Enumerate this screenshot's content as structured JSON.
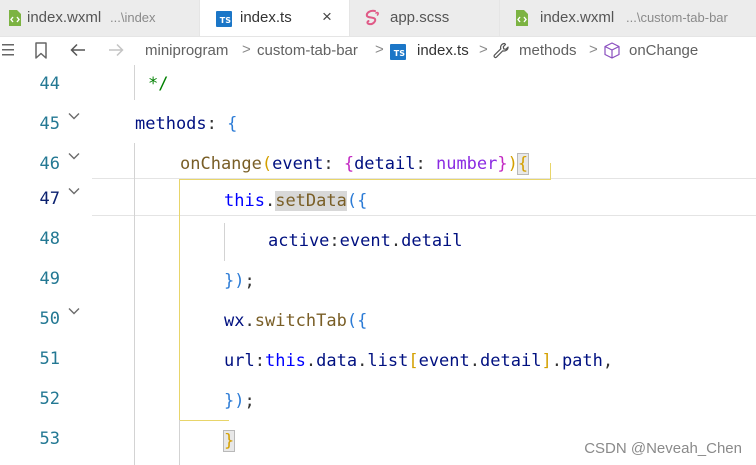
{
  "tabs": [
    {
      "label": "index.wxml",
      "description": "...\\index",
      "icon": "wxml-file-icon",
      "active": false
    },
    {
      "label": "index.ts",
      "description": "",
      "icon": "typescript-file-icon",
      "active": true,
      "close": "×"
    },
    {
      "label": "app.scss",
      "description": "",
      "icon": "sass-file-icon",
      "active": false
    },
    {
      "label": "index.wxml",
      "description": "...\\custom-tab-bar",
      "icon": "wxml-file-icon",
      "active": false
    }
  ],
  "ts_badge": "TS",
  "breadcrumb": {
    "items": [
      "miniprogram",
      "custom-tab-bar",
      "index.ts",
      "methods",
      "onChange"
    ],
    "separator": ">"
  },
  "editor": {
    "line_numbers": [
      "44",
      "45",
      "46",
      "47",
      "48",
      "49",
      "50",
      "51",
      "52",
      "53"
    ],
    "current_line": "47",
    "tokens": {
      "l44": [
        "*/"
      ],
      "l45": [
        "methods",
        ": ",
        "{"
      ],
      "l46": [
        "onChange",
        "(",
        "event",
        ": ",
        "{",
        "detail",
        ": ",
        "number",
        "}",
        ")",
        "{"
      ],
      "l47": [
        "this",
        ".",
        "setData",
        "(",
        "{"
      ],
      "l48": [
        "active",
        ":",
        "event",
        ".",
        "detail"
      ],
      "l49": [
        "}",
        ")",
        ";"
      ],
      "l50": [
        "wx",
        ".",
        "switchTab",
        "(",
        "{"
      ],
      "l51": [
        "url",
        ":",
        "this",
        ".",
        "data",
        ".",
        "list",
        "[",
        "event",
        ".",
        "detail",
        "]",
        ".",
        "path",
        ","
      ],
      "l52": [
        "}",
        ")",
        ";"
      ],
      "l53": [
        "}"
      ]
    }
  },
  "watermark": "CSDN @Neveah_Chen",
  "colors": {
    "line_number": "#237893",
    "comment": "#008000",
    "property": "#001080",
    "function": "#795e26",
    "keyword_this": "#0000ff",
    "type": "#8a2be2",
    "bracket_level1": "#d4a000",
    "bracket_level2": "#c227c2",
    "bracket_level3": "#2b7bd6",
    "ts_icon": "#1b76c7",
    "wxml_icon": "#7cb342",
    "sass_icon": "#e05a87"
  }
}
